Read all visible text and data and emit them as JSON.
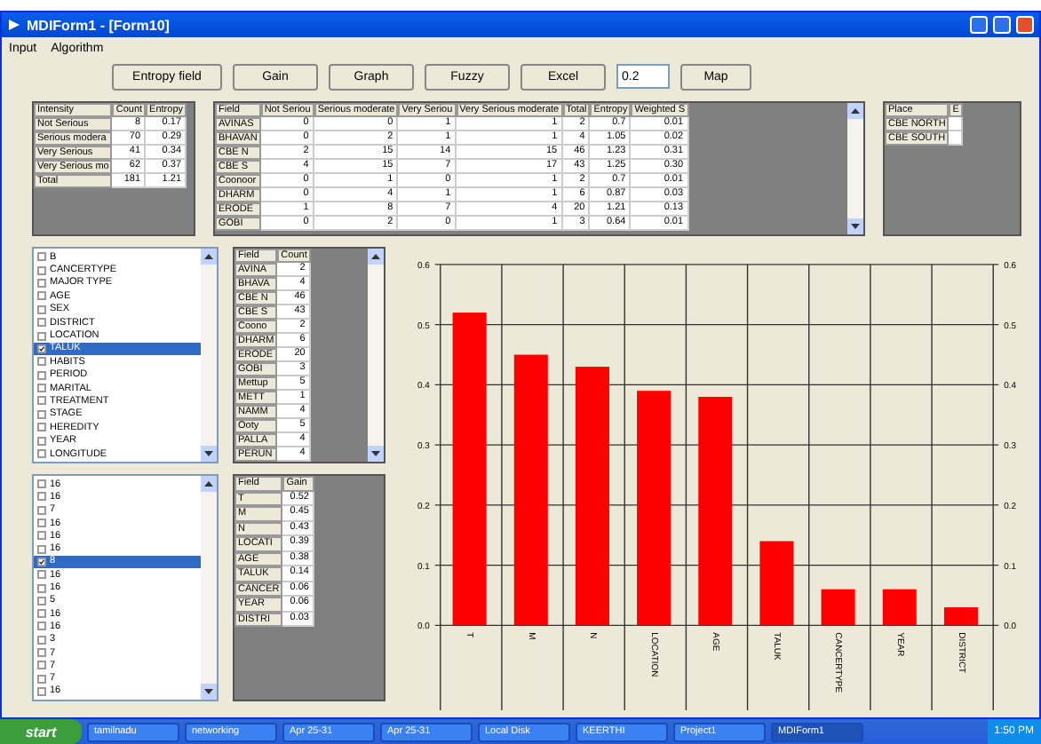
{
  "window": {
    "title": "MDIForm1 - [Form10]"
  },
  "menu": [
    "Input",
    "Algorithm"
  ],
  "toolbar": [
    {
      "kind": "button",
      "label": "Entropy field"
    },
    {
      "kind": "button",
      "label": "Gain"
    },
    {
      "kind": "button",
      "label": "Graph"
    },
    {
      "kind": "button",
      "label": "Fuzzy"
    },
    {
      "kind": "button",
      "label": "Excel"
    },
    {
      "kind": "field",
      "value": "0.2"
    },
    {
      "kind": "button",
      "label": "Map"
    }
  ],
  "intensity_table": {
    "columns": [
      "Intensity",
      "Count",
      "Entropy"
    ],
    "rows": [
      [
        "Not Serious",
        "8",
        "0.17"
      ],
      [
        "Serious modera",
        "70",
        "0.29"
      ],
      [
        "Very Serious",
        "41",
        "0.34"
      ],
      [
        "Very Serious mo",
        "62",
        "0.37"
      ],
      [
        "Total",
        "181",
        "1.21"
      ]
    ]
  },
  "field_table": {
    "columns": [
      "Field",
      "Not Seriou",
      "Serious moderate",
      "Very Seriou",
      "Very Serious moderate",
      "Total",
      "Entropy",
      "Weighted S"
    ],
    "rows": [
      [
        "AVINAS",
        "0",
        "0",
        "1",
        "1",
        "2",
        "0.7",
        "0.01"
      ],
      [
        "BHAVAN",
        "0",
        "2",
        "1",
        "1",
        "4",
        "1.05",
        "0.02"
      ],
      [
        "CBE N",
        "2",
        "15",
        "14",
        "15",
        "46",
        "1.23",
        "0.31"
      ],
      [
        "CBE S",
        "4",
        "15",
        "7",
        "17",
        "43",
        "1.25",
        "0.30"
      ],
      [
        "Coonoor",
        "0",
        "1",
        "0",
        "1",
        "2",
        "0.7",
        "0.01"
      ],
      [
        "DHARM",
        "0",
        "4",
        "1",
        "1",
        "6",
        "0.87",
        "0.03"
      ],
      [
        "ERODE",
        "1",
        "8",
        "7",
        "4",
        "20",
        "1.21",
        "0.13"
      ],
      [
        "GOBI",
        "0",
        "2",
        "0",
        "1",
        "3",
        "0.64",
        "0.01"
      ]
    ]
  },
  "place_table": {
    "columns": [
      "Place",
      "E"
    ],
    "rows": [
      [
        "CBE NORTH"
      ],
      [
        "CBE SOUTH"
      ]
    ]
  },
  "attribute_list": [
    {
      "label": "B",
      "checked": false,
      "selected": false
    },
    {
      "label": "CANCERTYPE",
      "checked": false,
      "selected": false
    },
    {
      "label": "MAJOR TYPE",
      "checked": false,
      "selected": false
    },
    {
      "label": "AGE",
      "checked": false,
      "selected": false
    },
    {
      "label": "SEX",
      "checked": false,
      "selected": false
    },
    {
      "label": "DISTRICT",
      "checked": false,
      "selected": false
    },
    {
      "label": "LOCATION",
      "checked": false,
      "selected": false
    },
    {
      "label": "TALUK",
      "checked": true,
      "selected": true
    },
    {
      "label": "HABITS",
      "checked": false,
      "selected": false
    },
    {
      "label": "PERIOD",
      "checked": false,
      "selected": false
    },
    {
      "label": "MARITAL",
      "checked": false,
      "selected": false
    },
    {
      "label": "TREATMENT",
      "checked": false,
      "selected": false
    },
    {
      "label": "STAGE",
      "checked": false,
      "selected": false
    },
    {
      "label": "HEREDITY",
      "checked": false,
      "selected": false
    },
    {
      "label": "YEAR",
      "checked": false,
      "selected": false
    },
    {
      "label": "LONGITUDE",
      "checked": false,
      "selected": false
    }
  ],
  "count_table": {
    "columns": [
      "Field",
      "Count"
    ],
    "rows": [
      [
        "AVINA",
        "2"
      ],
      [
        "BHAVA",
        "4"
      ],
      [
        "CBE N",
        "46"
      ],
      [
        "CBE S",
        "43"
      ],
      [
        "Coono",
        "2"
      ],
      [
        "DHARM",
        "6"
      ],
      [
        "ERODE",
        "20"
      ],
      [
        "GOBI",
        "3"
      ],
      [
        "Mettup",
        "5"
      ],
      [
        "METT",
        "1"
      ],
      [
        "NAMM",
        "4"
      ],
      [
        "Ooty",
        "5"
      ],
      [
        "PALLA",
        "4"
      ],
      [
        "PERUN",
        "4"
      ]
    ]
  },
  "value_list": [
    {
      "label": "16",
      "checked": false,
      "selected": false
    },
    {
      "label": "16",
      "checked": false,
      "selected": false
    },
    {
      "label": "7",
      "checked": false,
      "selected": false
    },
    {
      "label": "16",
      "checked": false,
      "selected": false
    },
    {
      "label": "16",
      "checked": false,
      "selected": false
    },
    {
      "label": "16",
      "checked": false,
      "selected": false
    },
    {
      "label": "8",
      "checked": true,
      "selected": true
    },
    {
      "label": "16",
      "checked": false,
      "selected": false
    },
    {
      "label": "16",
      "checked": false,
      "selected": false
    },
    {
      "label": "5",
      "checked": false,
      "selected": false
    },
    {
      "label": "16",
      "checked": false,
      "selected": false
    },
    {
      "label": "16",
      "checked": false,
      "selected": false
    },
    {
      "label": "3",
      "checked": false,
      "selected": false
    },
    {
      "label": "7",
      "checked": false,
      "selected": false
    },
    {
      "label": "7",
      "checked": false,
      "selected": false
    },
    {
      "label": "7",
      "checked": false,
      "selected": false
    },
    {
      "label": "16",
      "checked": false,
      "selected": false
    }
  ],
  "gain_table": {
    "columns": [
      "Field",
      "Gain"
    ],
    "rows": [
      [
        "T",
        "0.52"
      ],
      [
        "M",
        "0.45"
      ],
      [
        "N",
        "0.43"
      ],
      [
        "LOCATI",
        "0.39"
      ],
      [
        "AGE",
        "0.38"
      ],
      [
        "TALUK",
        "0.14"
      ],
      [
        "CANCER",
        "0.06"
      ],
      [
        "YEAR",
        "0.06"
      ],
      [
        "DISTRI",
        "0.03"
      ]
    ]
  },
  "chart": {
    "chart_data": {
      "type": "bar",
      "categories": [
        "T",
        "M",
        "N",
        "LOCATION",
        "AGE",
        "TALUK",
        "CANCERTYPE",
        "YEAR",
        "DISTRICT"
      ],
      "grid": true,
      "series": [
        {
          "color": "#ff0000",
          "values": [
            0.52,
            0.45,
            0.43,
            0.39,
            0.38,
            0.14,
            0.06,
            0.06,
            0.03
          ]
        }
      ],
      "ylim": [
        0,
        0.6
      ],
      "yticks": [
        {
          "value": 0,
          "label": "0.0"
        },
        {
          "value": 0.1,
          "label": "0.1"
        },
        {
          "value": 0.2,
          "label": "0.2"
        },
        {
          "value": 0.3,
          "label": "0.3"
        },
        {
          "value": 0.4,
          "label": "0.4"
        },
        {
          "value": 0.5,
          "label": "0.5"
        },
        {
          "value": 0.6,
          "label": "0.6"
        }
      ]
    }
  },
  "taskbar": {
    "start": "start",
    "tasks": [
      {
        "label": "tamilnadu",
        "selected": false
      },
      {
        "label": "networking",
        "selected": false
      },
      {
        "label": "Apr 25-31",
        "selected": false
      },
      {
        "label": "Apr 25-31",
        "selected": false
      },
      {
        "label": "Local Disk",
        "selected": false
      },
      {
        "label": "KEERTHI",
        "selected": false
      },
      {
        "label": "Project1",
        "selected": false
      },
      {
        "label": "MDIForm1",
        "selected": true
      }
    ],
    "clock": "1:50 PM"
  }
}
